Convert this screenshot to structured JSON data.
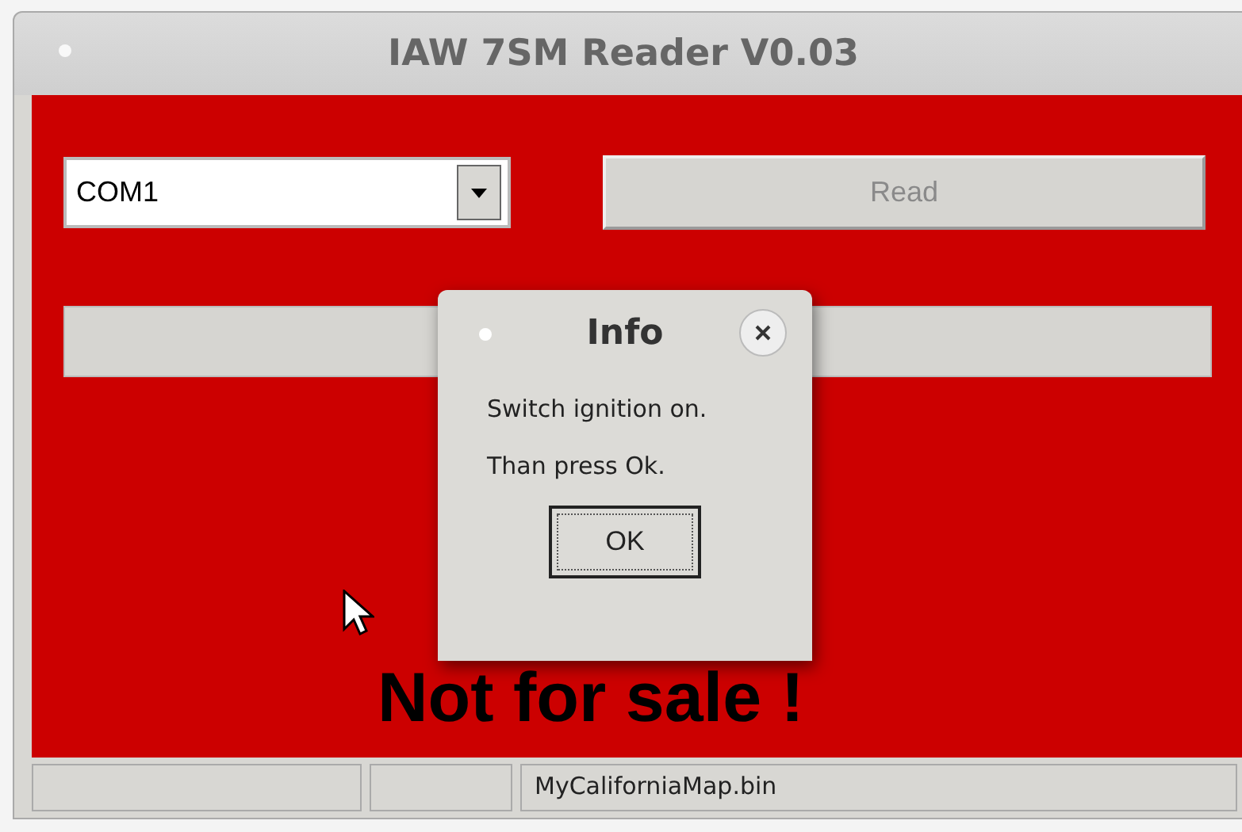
{
  "window": {
    "title": "IAW 7SM Reader V0.03"
  },
  "port_select": {
    "value": "COM1"
  },
  "read_button": {
    "label": "Read",
    "disabled": true
  },
  "progress": {
    "level": 0
  },
  "banner": "Not for sale !",
  "dialog": {
    "title": "Info",
    "lines": [
      "Switch ignition on.",
      "Than press Ok."
    ],
    "button": "OK"
  },
  "status_bar": [
    {
      "kind": "empty"
    },
    {
      "kind": "empty"
    },
    {
      "kind": "text",
      "text": "MyCaliforniaMap.bin"
    }
  ]
}
